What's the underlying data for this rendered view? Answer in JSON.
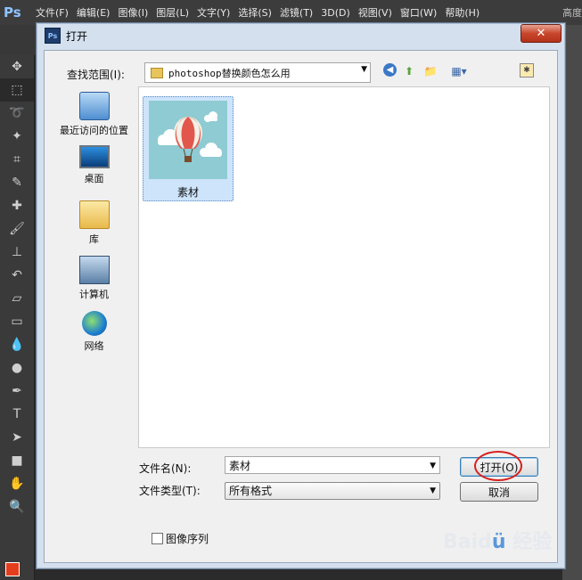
{
  "ps": {
    "logo": "Ps",
    "menu": [
      "文件(F)",
      "编辑(E)",
      "图像(I)",
      "图层(L)",
      "文字(Y)",
      "选择(S)",
      "滤镜(T)",
      "3D(D)",
      "视图(V)",
      "窗口(W)",
      "帮助(H)"
    ],
    "menu_overflow": "高度",
    "tools": [
      "move-icon",
      "marquee-icon",
      "lasso-icon",
      "magic-wand-icon",
      "crop-icon",
      "eyedropper-icon",
      "healing-icon",
      "brush-icon",
      "stamp-icon",
      "history-brush-icon",
      "eraser-icon",
      "gradient-icon",
      "blur-icon",
      "dodge-icon",
      "pen-icon",
      "type-icon",
      "path-select-icon",
      "shape-icon",
      "hand-icon",
      "zoom-icon"
    ],
    "foreground_color": "#e43d1d"
  },
  "dialog": {
    "icon": "Ps",
    "title": "打开",
    "close": "✕",
    "lookin_label": "查找范围(I):",
    "lookin_value": "photoshop替换颜色怎么用",
    "places": {
      "recent": "最近访问的位置",
      "desktop": "桌面",
      "library": "库",
      "computer": "计算机",
      "network": "网络"
    },
    "files": [
      {
        "name": "素材"
      }
    ],
    "filename_label": "文件名(N):",
    "filename_value": "素材",
    "filetype_label": "文件类型(T):",
    "filetype_value": "所有格式",
    "open_button": "打开(O)",
    "cancel_button": "取消",
    "sequence_label": "图像序列",
    "sequence_checked": false
  },
  "watermark": "Baidu 经验"
}
